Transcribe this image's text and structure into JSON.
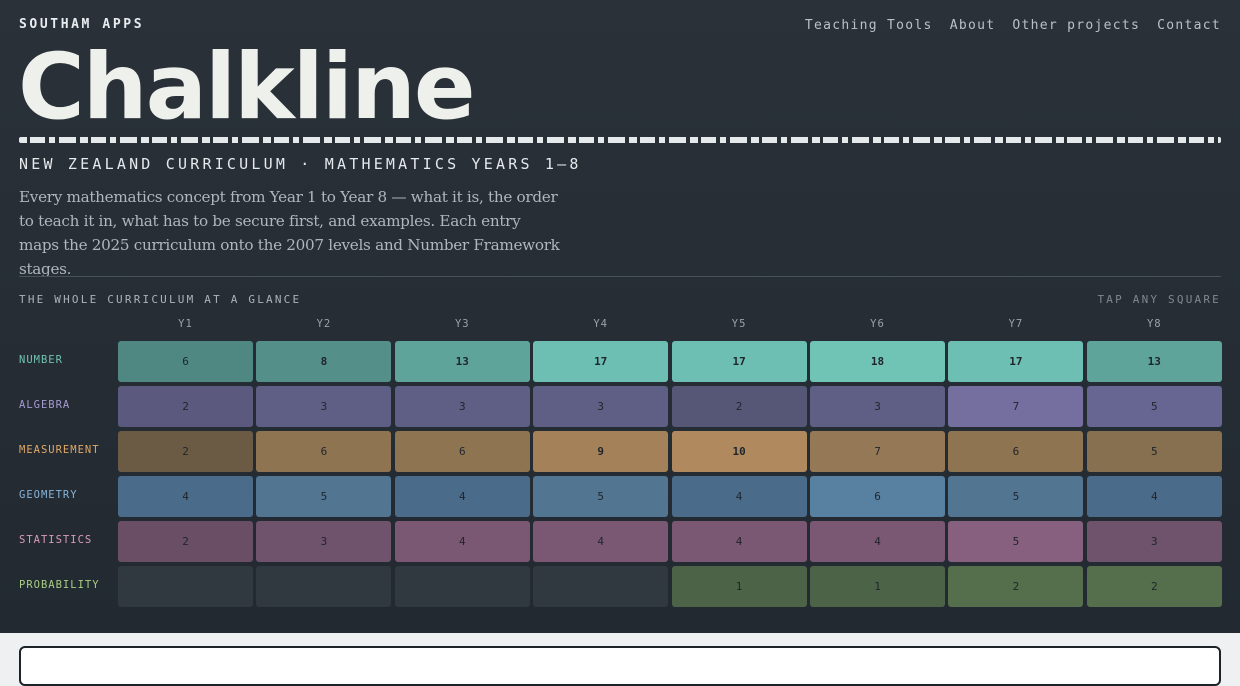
{
  "header": {
    "brand": "SOUTHAM APPS",
    "nav": [
      "Teaching Tools",
      "About",
      "Other projects",
      "Contact"
    ]
  },
  "hero": {
    "title": "Chalkline",
    "subtitle": "NEW ZEALAND CURRICULUM · MATHEMATICS YEARS 1–8",
    "intro": "Every mathematics concept from Year 1 to Year 8 — what it is, the order to teach it in, what has to be secure first, and examples. Each entry maps the 2025 curriculum onto the 2007 levels and Number Framework stages."
  },
  "overview": {
    "label": "THE WHOLE CURRICULUM AT A GLANCE",
    "hint": "TAP ANY SQUARE",
    "years": [
      "Y1",
      "Y2",
      "Y3",
      "Y4",
      "Y5",
      "Y6",
      "Y7",
      "Y8"
    ],
    "strands": [
      {
        "name": "NUMBER",
        "label_color": "#6fc3b4",
        "counts": [
          "6",
          "8",
          "13",
          "17",
          "17",
          "18",
          "17",
          "13"
        ],
        "colors": [
          "#4f8883",
          "#548f89",
          "#5fa49b",
          "#6cbfb2",
          "#6cbfb2",
          "#70c4b6",
          "#6cbfb2",
          "#5fa49b"
        ]
      },
      {
        "name": "ALGEBRA",
        "label_color": "#a59bd0",
        "counts": [
          "2",
          "3",
          "3",
          "3",
          "2",
          "3",
          "7",
          "5"
        ],
        "colors": [
          "#5b5a7e",
          "#5f5e84",
          "#5f5e84",
          "#5f5e84",
          "#565677",
          "#5f5e84",
          "#746f9e",
          "#676592"
        ]
      },
      {
        "name": "MEASUREMENT",
        "label_color": "#e0a967",
        "counts": [
          "2",
          "6",
          "6",
          "9",
          "10",
          "7",
          "6",
          "5"
        ],
        "colors": [
          "#6b5b45",
          "#8f7452",
          "#8f7452",
          "#a5815a",
          "#b08a5e",
          "#957856",
          "#8f7452",
          "#86704f"
        ]
      },
      {
        "name": "GEOMETRY",
        "label_color": "#86b4da",
        "counts": [
          "4",
          "5",
          "4",
          "5",
          "4",
          "6",
          "5",
          "4"
        ],
        "colors": [
          "#4b6b8a",
          "#527592",
          "#4b6b8a",
          "#527592",
          "#4b6b8a",
          "#5880a0",
          "#527592",
          "#4b6b8a"
        ]
      },
      {
        "name": "STATISTICS",
        "label_color": "#d99bb8",
        "counts": [
          "2",
          "3",
          "4",
          "4",
          "4",
          "4",
          "5",
          "3"
        ],
        "colors": [
          "#6a4e65",
          "#6f526b",
          "#7a5873",
          "#7a5873",
          "#7a5873",
          "#7a5873",
          "#875f7f",
          "#6f526b"
        ]
      },
      {
        "name": "PROBABILITY",
        "label_color": "#a9cf84",
        "counts": [
          "",
          "",
          "",
          "",
          "1",
          "1",
          "2",
          "2"
        ],
        "colors": [
          "#303840",
          "#303840",
          "#303840",
          "#303840",
          "#4c6347",
          "#4c6347",
          "#556f4c",
          "#556f4c"
        ]
      }
    ]
  }
}
